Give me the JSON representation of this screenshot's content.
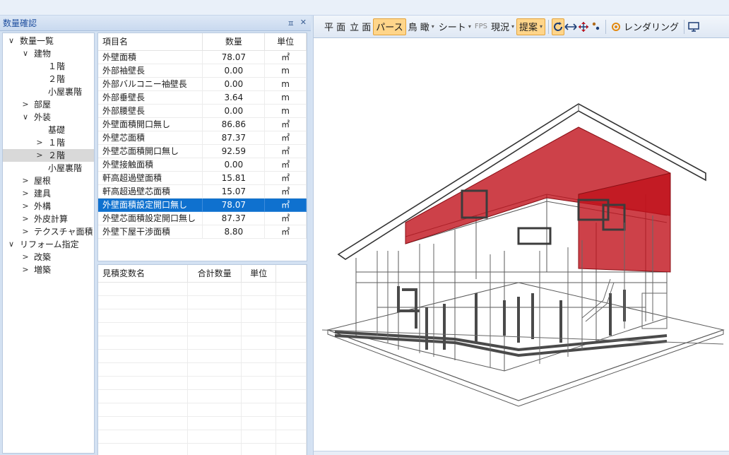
{
  "panel": {
    "title": "数量確認",
    "pin_glyph": "ㅍ",
    "close_glyph": "✕"
  },
  "tree": [
    {
      "label": "数量一覧",
      "level": 0,
      "toggle": "∨"
    },
    {
      "label": "建物",
      "level": 1,
      "toggle": "∨"
    },
    {
      "label": "１階",
      "level": 3,
      "toggle": ""
    },
    {
      "label": "２階",
      "level": 3,
      "toggle": ""
    },
    {
      "label": "小屋裏階",
      "level": 3,
      "toggle": ""
    },
    {
      "label": "部屋",
      "level": 1,
      "toggle": ">"
    },
    {
      "label": "外装",
      "level": 1,
      "toggle": "∨"
    },
    {
      "label": "基礎",
      "level": 3,
      "toggle": ""
    },
    {
      "label": "１階",
      "level": 2,
      "toggle": ">"
    },
    {
      "label": "２階",
      "level": 2,
      "toggle": ">",
      "selected": true
    },
    {
      "label": "小屋裏階",
      "level": 3,
      "toggle": ""
    },
    {
      "label": "屋根",
      "level": 1,
      "toggle": ">"
    },
    {
      "label": "建具",
      "level": 1,
      "toggle": ">"
    },
    {
      "label": "外構",
      "level": 1,
      "toggle": ">"
    },
    {
      "label": "外皮計算",
      "level": 1,
      "toggle": ">"
    },
    {
      "label": "テクスチャ面積",
      "level": 1,
      "toggle": ">"
    },
    {
      "label": "リフォーム指定",
      "level": 0,
      "toggle": "∨"
    },
    {
      "label": "改築",
      "level": 1,
      "toggle": ">"
    },
    {
      "label": "増築",
      "level": 1,
      "toggle": ">"
    }
  ],
  "quantity_table": {
    "headers": [
      "項目名",
      "数量",
      "単位"
    ],
    "rows": [
      {
        "name": "外壁面積",
        "qty": "78.07",
        "unit": "㎡"
      },
      {
        "name": "外部袖壁長",
        "qty": "0.00",
        "unit": "m"
      },
      {
        "name": "外部バルコニー袖壁長",
        "qty": "0.00",
        "unit": "m"
      },
      {
        "name": "外部垂壁長",
        "qty": "3.64",
        "unit": "m"
      },
      {
        "name": "外部腰壁長",
        "qty": "0.00",
        "unit": "m"
      },
      {
        "name": "外壁面積開口無し",
        "qty": "86.86",
        "unit": "㎡"
      },
      {
        "name": "外壁芯面積",
        "qty": "87.37",
        "unit": "㎡"
      },
      {
        "name": "外壁芯面積開口無し",
        "qty": "92.59",
        "unit": "㎡"
      },
      {
        "name": "外壁接触面積",
        "qty": "0.00",
        "unit": "㎡"
      },
      {
        "name": "軒高超過壁面積",
        "qty": "15.81",
        "unit": "㎡"
      },
      {
        "name": "軒高超過壁芯面積",
        "qty": "15.07",
        "unit": "㎡"
      },
      {
        "name": "外壁面積設定開口無し",
        "qty": "78.07",
        "unit": "㎡",
        "selected": true
      },
      {
        "name": "外壁芯面積設定開口無し",
        "qty": "87.37",
        "unit": "㎡"
      },
      {
        "name": "外壁下屋干渉面積",
        "qty": "8.80",
        "unit": "㎡"
      }
    ]
  },
  "estimate_table": {
    "headers": [
      "見積変数名",
      "合計数量",
      "単位"
    ],
    "rows": []
  },
  "toolbar": {
    "plan": "平 面",
    "elevation": "立 面",
    "perspective": "パース",
    "birdseye": "鳥 瞰",
    "sheet": "シート",
    "fps": "FPS",
    "current": "現況",
    "proposal": "提案",
    "render": "レンダリング",
    "dropdown_glyph": "▾"
  },
  "colors": {
    "selection_blue": "#0f71cf",
    "active_button": "#ffd58a",
    "wall_highlight": "#c0121b",
    "wireframe": "#4a4a4a"
  }
}
